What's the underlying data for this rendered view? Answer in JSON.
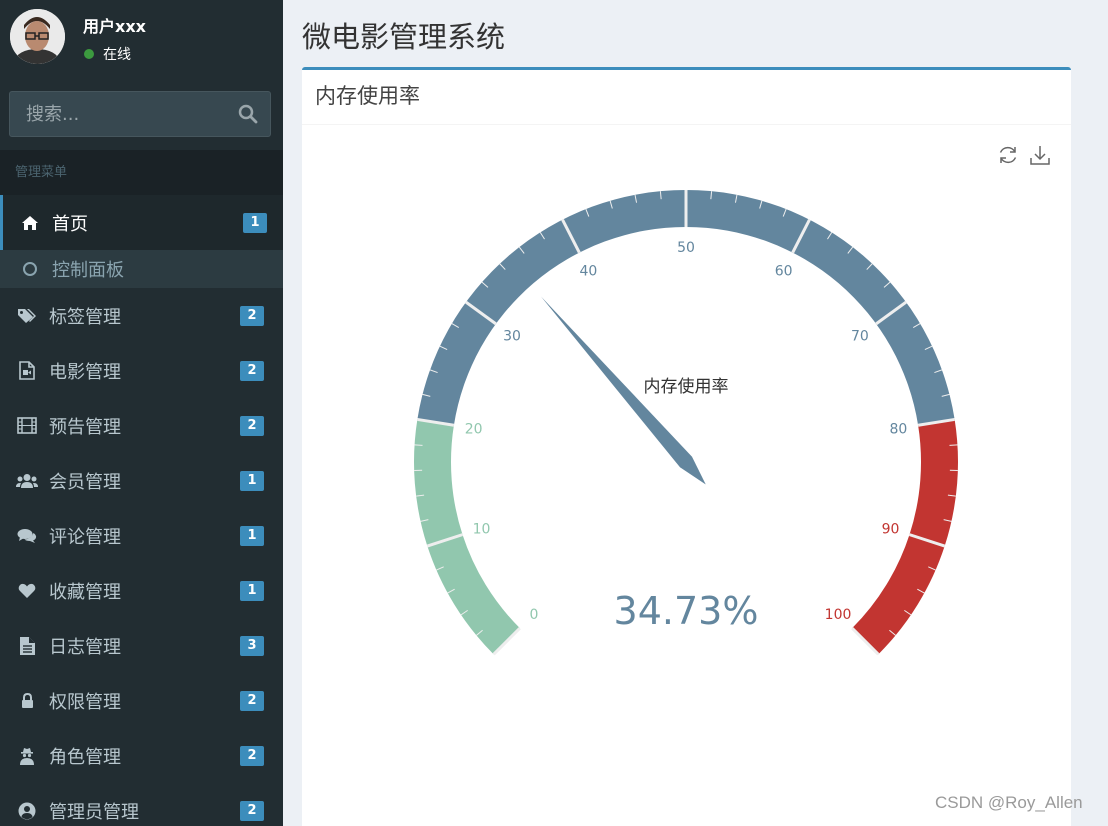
{
  "user": {
    "name": "用户xxx",
    "status": "在线"
  },
  "search": {
    "placeholder": "搜索..."
  },
  "menu_header": "管理菜单",
  "menu": [
    {
      "label": "首页",
      "badge": "1",
      "icon": "home-icon"
    },
    {
      "label": "标签管理",
      "badge": "2",
      "icon": "tags-icon"
    },
    {
      "label": "电影管理",
      "badge": "2",
      "icon": "file-video-icon"
    },
    {
      "label": "预告管理",
      "badge": "2",
      "icon": "film-icon"
    },
    {
      "label": "会员管理",
      "badge": "1",
      "icon": "users-icon"
    },
    {
      "label": "评论管理",
      "badge": "1",
      "icon": "comments-icon"
    },
    {
      "label": "收藏管理",
      "badge": "1",
      "icon": "heart-icon"
    },
    {
      "label": "日志管理",
      "badge": "3",
      "icon": "file-text-icon"
    },
    {
      "label": "权限管理",
      "badge": "2",
      "icon": "lock-icon"
    },
    {
      "label": "角色管理",
      "badge": "2",
      "icon": "user-secret-icon"
    },
    {
      "label": "管理员管理",
      "badge": "2",
      "icon": "user-circle-icon"
    }
  ],
  "submenu": {
    "label": "控制面板"
  },
  "page": {
    "title": "微电影管理系统"
  },
  "box": {
    "title": "内存使用率"
  },
  "toolbox": {
    "restore": "refresh-icon",
    "save": "download-icon"
  },
  "gauge": {
    "title": "内存使用率",
    "value": 34.73,
    "value_label": "34.73%",
    "min": 0,
    "max": 100,
    "ticks": [
      "0",
      "10",
      "20",
      "30",
      "40",
      "50",
      "60",
      "70",
      "80",
      "90",
      "100"
    ],
    "bands": [
      {
        "to": 0.2,
        "color": "#91c7ae"
      },
      {
        "to": 0.8,
        "color": "#63869e"
      },
      {
        "to": 1.0,
        "color": "#c23531"
      }
    ]
  },
  "watermark": "CSDN @Roy_Allen"
}
